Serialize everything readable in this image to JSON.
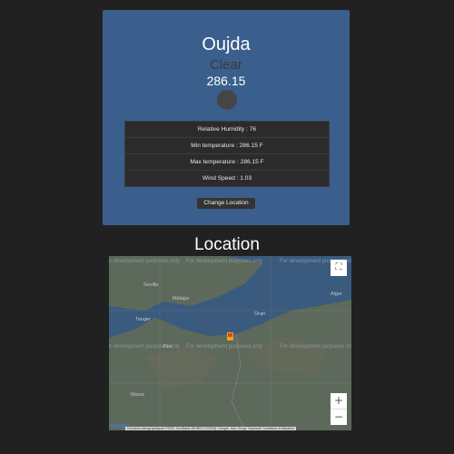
{
  "weather": {
    "city": "Oujda",
    "condition": "Clear",
    "temperature": "286.15",
    "icon": "weather-icon",
    "details": [
      "Relative Humidity : 76",
      "Min temperature : 286.15 F",
      "Max temperature : 286.15 F",
      "Wind Speed : 1.03"
    ],
    "change_location_label": "Change Location"
  },
  "location": {
    "heading": "Location",
    "map": {
      "watermark": "For development purposes only",
      "labels": {
        "sevilla": "Sevilla",
        "malaga": "Málaga",
        "tanger": "Tanger",
        "oran": "Oran",
        "alger": "Alger",
        "fes": "Fès",
        "maroc": "Maroc"
      },
      "zoom_in": "+",
      "zoom_out": "−",
      "fullscreen_icon": "fullscreen-icon",
      "attribution": "Données cartographiques ©2021 GeoBasis-DE/BKG (©2009), Google, Inst. Geogr. Nacional    Conditions d'utilisation",
      "logo": "Google"
    }
  },
  "colors": {
    "background": "#212121",
    "card": "#3a5f8c",
    "table": "#2b2b2b",
    "button": "#333333",
    "sea": "#3a5a7e",
    "land": "#5d6a5b"
  }
}
